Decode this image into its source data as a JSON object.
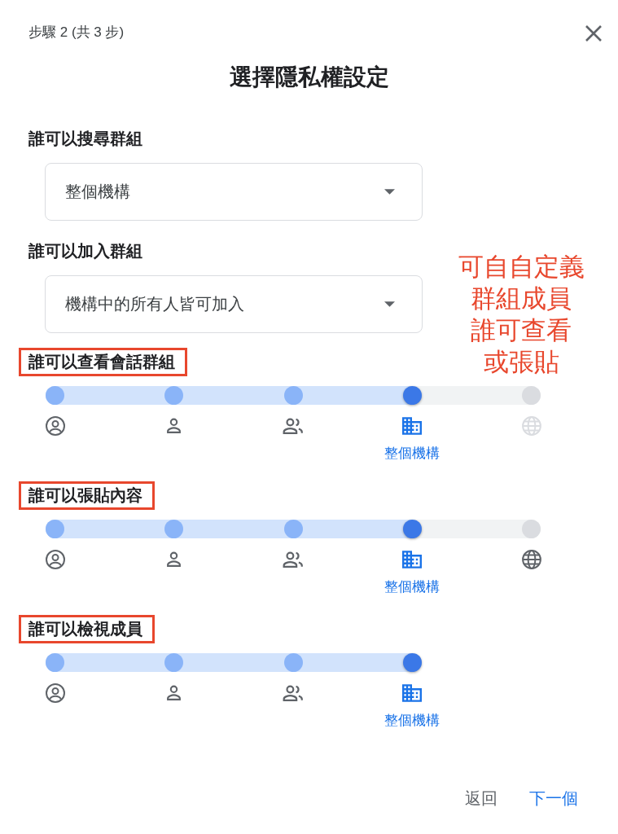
{
  "dialog": {
    "step": "步驟 2 (共 3 步)",
    "title": "選擇隱私權設定"
  },
  "dropdowns": [
    {
      "label": "誰可以搜尋群組",
      "value": "整個機構"
    },
    {
      "label": "誰可以加入群組",
      "value": "機構中的所有人皆可加入"
    }
  ],
  "annotation": {
    "lines": [
      "可自自定義",
      "群組成員",
      "誰可查看",
      "或張貼"
    ]
  },
  "sliders": [
    {
      "label": "誰可以查看會話群組",
      "highlighted": true,
      "level": 0.75,
      "stops": [
        {
          "kind": "account",
          "selected": false,
          "disabled": false
        },
        {
          "kind": "person",
          "selected": false,
          "disabled": false
        },
        {
          "kind": "people",
          "selected": false,
          "disabled": false
        },
        {
          "kind": "building",
          "selected": true,
          "disabled": false,
          "label": "整個機構"
        },
        {
          "kind": "globe",
          "selected": false,
          "disabled": true
        }
      ]
    },
    {
      "label": "誰可以張貼內容",
      "highlighted": true,
      "level": 0.75,
      "stops": [
        {
          "kind": "account",
          "selected": false,
          "disabled": false
        },
        {
          "kind": "person",
          "selected": false,
          "disabled": false
        },
        {
          "kind": "people",
          "selected": false,
          "disabled": false
        },
        {
          "kind": "building",
          "selected": true,
          "disabled": false,
          "label": "整個機構"
        },
        {
          "kind": "globe",
          "selected": false,
          "disabled": false
        }
      ]
    },
    {
      "label": "誰可以檢視成員",
      "highlighted": true,
      "level": 1,
      "stops": [
        {
          "kind": "account",
          "selected": false,
          "disabled": false
        },
        {
          "kind": "person",
          "selected": false,
          "disabled": false
        },
        {
          "kind": "people",
          "selected": false,
          "disabled": false
        },
        {
          "kind": "building",
          "selected": true,
          "disabled": false,
          "label": "整個機構"
        }
      ]
    }
  ],
  "footer": {
    "buttons": [
      {
        "label": "返回",
        "kind": "secondary"
      },
      {
        "label": "下一個",
        "kind": "primary"
      }
    ]
  }
}
